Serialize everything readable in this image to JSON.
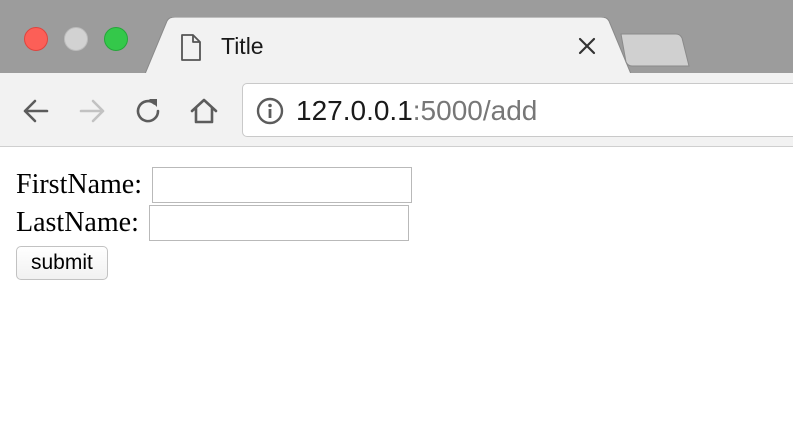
{
  "browser": {
    "tab": {
      "title": "Title",
      "close_icon": "close-icon",
      "page_icon": "document-icon"
    },
    "new_tab_icon": "new-tab-icon",
    "nav": {
      "back_icon": "back-arrow-icon",
      "forward_icon": "forward-arrow-icon",
      "reload_icon": "reload-icon",
      "home_icon": "home-icon"
    },
    "address_bar": {
      "info_icon": "info-icon",
      "host": "127.0.0.1",
      "path": ":5000/add"
    },
    "window_controls": [
      "close",
      "minimize",
      "maximize"
    ],
    "colors": {
      "close": "#fc5f57",
      "minimize": "#d2d2d2",
      "maximize": "#34c84a"
    }
  },
  "form": {
    "first_name_label": "FirstName:",
    "first_name_value": "",
    "last_name_label": "LastName:",
    "last_name_value": "",
    "submit_label": "submit"
  }
}
